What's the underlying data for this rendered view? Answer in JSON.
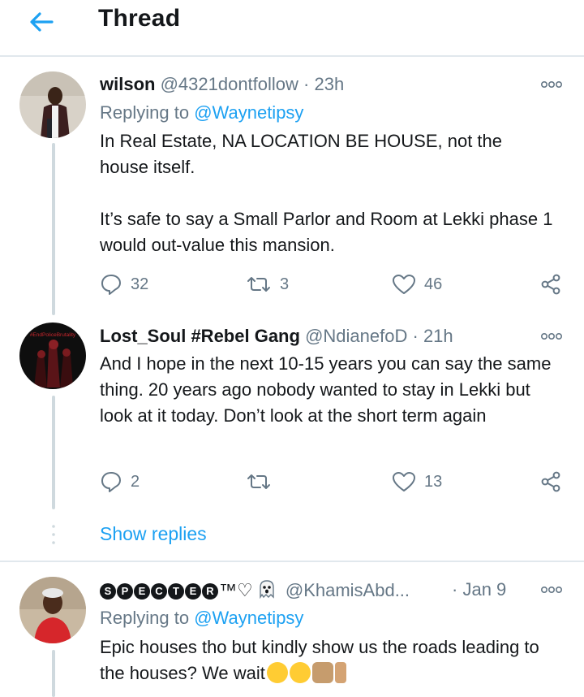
{
  "header": {
    "title": "Thread"
  },
  "tweets": [
    {
      "name": "wilson",
      "handle": "@4321dontfollow",
      "separator": "·",
      "time": "23h",
      "replying_prefix": "Replying to",
      "replying_to": "@Waynetipsy",
      "text": [
        "In Real Estate, NA LOCATION BE HOUSE, not the house itself.",
        "It’s safe to say a Small Parlor and Room at Lekki phase 1 would out-value this mansion."
      ],
      "replies": "32",
      "retweets": "3",
      "likes": "46"
    },
    {
      "name": "Lost_Soul #Rebel Gang",
      "handle": "@NdianefoD",
      "separator": "·",
      "time": "21h",
      "avatar_caption": "#EndPoliceBrutality",
      "text": [
        "And I hope in the next 10-15 years you can say the same thing. 20 years ago nobody wanted to stay in Lekki but look at it today. Don’t look at the short term again"
      ],
      "replies": "2",
      "retweets": "",
      "likes": "13"
    },
    {
      "name_letters": [
        "S",
        "P",
        "E",
        "C",
        "T",
        "E",
        "R"
      ],
      "name_suffix": "™♡",
      "handle": "@KhamisAbd...",
      "separator": "·",
      "time": "Jan 9",
      "replying_prefix": "Replying to",
      "replying_to": "@Waynetipsy",
      "text": [
        "Epic houses tho but kindly show us the roads leading to the houses? We wait"
      ]
    }
  ],
  "show_replies": "Show replies",
  "colors": {
    "accent": "#1da1f2",
    "secondary": "#657786",
    "text": "#14171a",
    "divider": "#e1e8ed"
  }
}
